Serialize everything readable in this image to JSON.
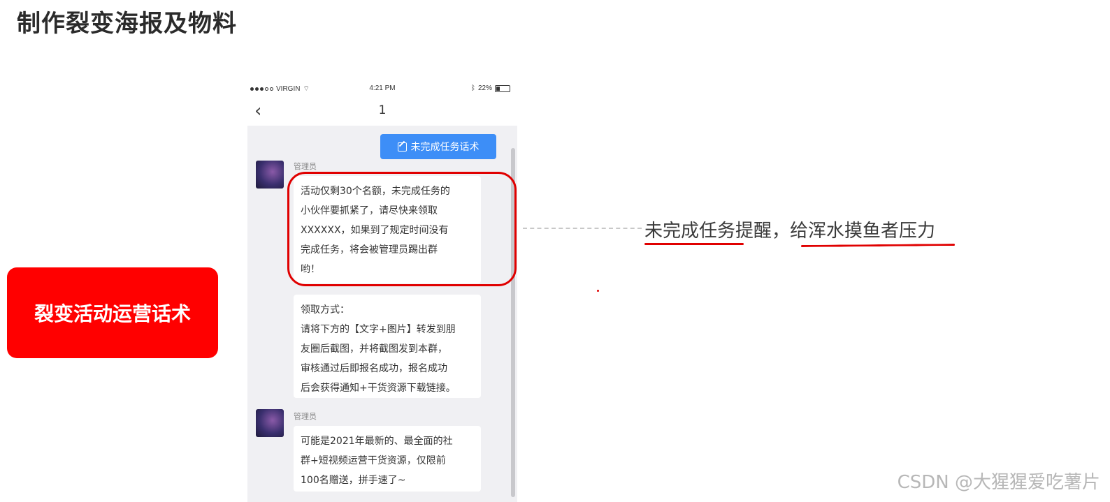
{
  "slide": {
    "title": "制作裂变海报及物料",
    "side_label": "裂变活动运营话术",
    "annotation": "未完成任务提醒，给浑水摸鱼者压力",
    "watermark": "CSDN @大猩猩爱吃薯片"
  },
  "status_bar": {
    "carrier": "VIRGIN",
    "time": "4:21 PM",
    "battery": "22%"
  },
  "nav": {
    "back_icon": "chevron-left-icon",
    "title": "1"
  },
  "chat": {
    "action_button": "未完成任务话术",
    "messages": [
      {
        "sender": "管理员",
        "text": "活动仅剩30个名额，未完成任务的\n小伙伴要抓紧了，请尽快来领取\nXXXXXX，如果到了规定时间没有\n完成任务，将会被管理员踢出群\n哟！"
      },
      {
        "text": "领取方式：\n请将下方的【文字+图片】转发到朋\n友圈后截图，并将截图发到本群，\n审核通过后即报名成功，报名成功\n后会获得通知+干货资源下载链接。"
      },
      {
        "sender": "管理员",
        "text": "可能是2021年最新的、最全面的社\n群+短视频运营干货资源，仅限前\n100名赠送，拼手速了~"
      }
    ]
  },
  "colors": {
    "accent_red": "#ff0000",
    "button_blue": "#3d8ef7",
    "chat_bg": "#f0f0f3"
  }
}
